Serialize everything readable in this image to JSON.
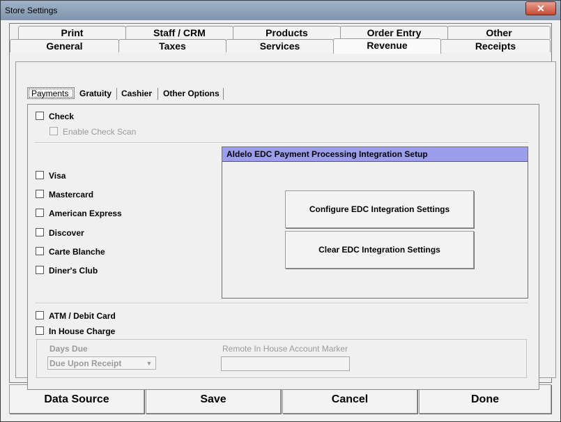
{
  "window": {
    "title": "Store Settings",
    "close_glyph": "✕"
  },
  "tabs_row_back": [
    {
      "label": "Print"
    },
    {
      "label": "Staff / CRM"
    },
    {
      "label": "Products"
    },
    {
      "label": "Order Entry"
    },
    {
      "label": "Other"
    }
  ],
  "tabs_row_front": [
    {
      "label": "General"
    },
    {
      "label": "Taxes"
    },
    {
      "label": "Services"
    },
    {
      "label": "Revenue",
      "active": true
    },
    {
      "label": "Receipts"
    }
  ],
  "subtabs": [
    {
      "label": "Payments",
      "active": true
    },
    {
      "label": "Gratuity"
    },
    {
      "label": "Cashier"
    },
    {
      "label": "Other Options"
    }
  ],
  "payments": {
    "check": {
      "label": "Check",
      "checked": false
    },
    "enable_check_scan": {
      "label": "Enable Check Scan",
      "checked": false,
      "disabled": true
    },
    "cards": [
      {
        "label": "Visa",
        "checked": false
      },
      {
        "label": "Mastercard",
        "checked": false
      },
      {
        "label": "American Express",
        "checked": false
      },
      {
        "label": "Discover",
        "checked": false
      },
      {
        "label": "Carte Blanche",
        "checked": false
      },
      {
        "label": "Diner's Club",
        "checked": false
      }
    ],
    "atm_debit": {
      "label": "ATM / Debit Card",
      "checked": false
    },
    "in_house_charge": {
      "label": "In House Charge",
      "checked": false
    }
  },
  "edc": {
    "header": "Aldelo EDC Payment Processing Integration Setup",
    "configure_label": "Configure EDC Integration Settings",
    "clear_label": "Clear EDC Integration Settings"
  },
  "in_house": {
    "days_due_label": "Days Due",
    "days_due_value": "Due Upon Receipt",
    "remote_marker_label": "Remote In House Account Marker",
    "remote_marker_value": ""
  },
  "buttons": {
    "data_source": "Data Source",
    "save": "Save",
    "cancel": "Cancel",
    "done": "Done"
  },
  "colors": {
    "edc_header_bg": "#9d9ded",
    "titlebar": "#8fa4bc",
    "close_button": "#c74b32"
  }
}
